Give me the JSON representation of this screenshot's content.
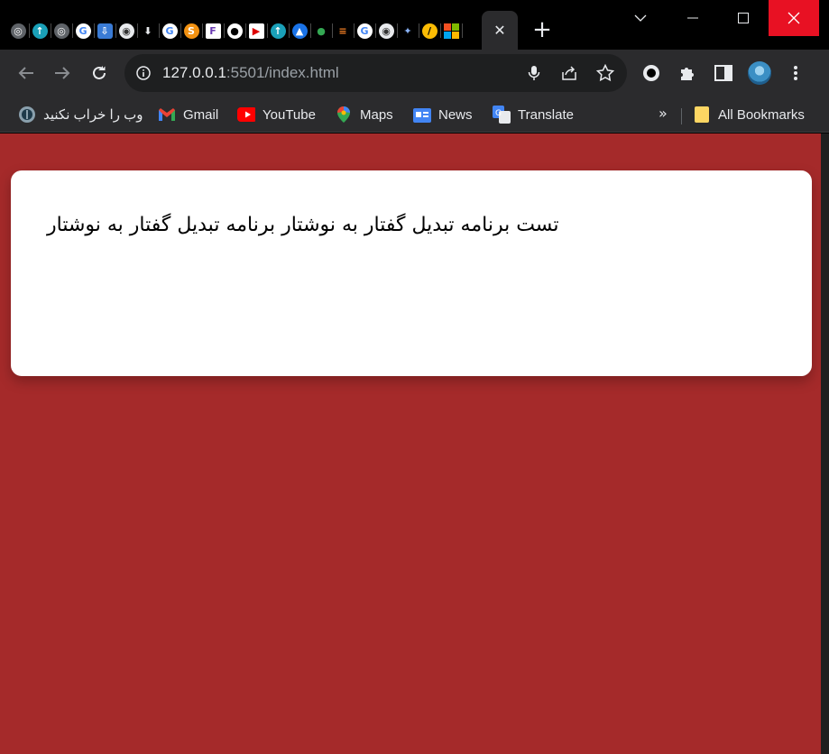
{
  "browser": {
    "tab_favicons": [
      "globe-icon",
      "tapsell-icon",
      "globe-icon",
      "google-icon",
      "inbox-download-icon",
      "chrome-icon",
      "download-icon",
      "google-icon",
      "orange-logo-icon",
      "f-logo-icon",
      "github-icon",
      "youtube-folder-icon",
      "tapsell-icon",
      "graduation-cap-icon",
      "maps-pin-icon",
      "stackoverflow-icon",
      "google-icon",
      "chrome-icon",
      "gemini-icon",
      "yellow-logo-icon",
      "microsoft-icon"
    ],
    "active_tab_close": "✕",
    "new_tab": "+",
    "url_host": "127.0.0.1",
    "url_rest": ":5501/index.html"
  },
  "bookmarks": {
    "items": [
      {
        "label": "وب را خراب نکنید",
        "icon": "tapsell-icon"
      },
      {
        "label": "Gmail",
        "icon": "gmail-icon"
      },
      {
        "label": "YouTube",
        "icon": "youtube-icon"
      },
      {
        "label": "Maps",
        "icon": "maps-pin-icon"
      },
      {
        "label": "News",
        "icon": "news-icon"
      },
      {
        "label": "Translate",
        "icon": "translate-icon"
      }
    ],
    "more": "»",
    "all_bookmarks": "All Bookmarks"
  },
  "page": {
    "background": "#a52a2a",
    "card_text": "تست برنامه تبدیل گفتار به نوشتار برنامه تبدیل گفتار به نوشتار"
  },
  "colors": {
    "close_red": "#e81123",
    "toolbar": "#2b2b2d",
    "omnibox": "#1e1f20"
  }
}
